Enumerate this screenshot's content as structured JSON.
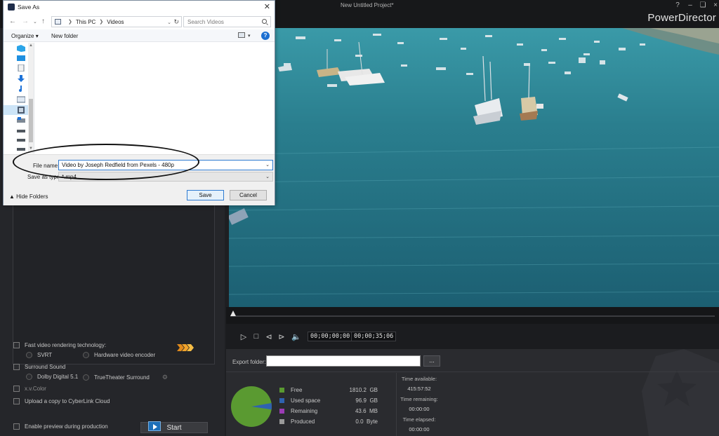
{
  "app": {
    "project_title": "New Untitled Project*",
    "brand": "PowerDirector",
    "help_glyph": "?"
  },
  "save_dialog": {
    "title": "Save As",
    "breadcrumb": [
      "This PC",
      "Videos"
    ],
    "search_placeholder": "Search Videos",
    "organize_label": "Organize",
    "new_folder_label": "New folder",
    "file_name_label": "File name:",
    "file_name_value": "Video by Joseph Redfield from Pexels - 480p",
    "save_as_type_label": "Save as type:",
    "save_as_type_value": "*.mp4",
    "hide_folders_label": "Hide Folders",
    "save_button": "Save",
    "cancel_button": "Cancel"
  },
  "options": {
    "fast_rendering": "Fast video rendering technology:",
    "svrt": "SVRT",
    "hardware_encoder": "Hardware video encoder",
    "surround_sound": "Surround Sound",
    "dolby": "Dolby Digital 5.1",
    "truetheater": "TrueTheater Surround",
    "xvcolor": "x.v.Color",
    "upload_cloud": "Upload a copy to CyberLink Cloud",
    "enable_preview": "Enable preview during production",
    "start_button": "Start"
  },
  "transport": {
    "timecode_current": "00;00;00;00",
    "timecode_total": "00;00;35;06"
  },
  "export": {
    "folder_label": "Export folder:",
    "folder_value": "",
    "browse_label": "..."
  },
  "storage": {
    "legend": [
      {
        "label": "Free",
        "value": "1810.2",
        "unit": "GB",
        "color": "#5a9a31"
      },
      {
        "label": "Used space",
        "value": "96.9",
        "unit": "GB",
        "color": "#2f62b0"
      },
      {
        "label": "Remaining",
        "value": "43.6",
        "unit": "MB",
        "color": "#9b3bb5"
      },
      {
        "label": "Produced",
        "value": "0.0",
        "unit": "Byte",
        "color": "#9a9a9a"
      }
    ],
    "used_fraction": 0.051
  },
  "times": {
    "available_label": "Time available:",
    "available_value": "415:57:52",
    "remaining_label": "Time remaining:",
    "remaining_value": "00:00:00",
    "elapsed_label": "Time elapsed:",
    "elapsed_value": "00:00:00"
  },
  "colors": {
    "accent": "#2f7bd1",
    "sea": "#2a7b8c",
    "app_bg": "#1e1f22"
  }
}
